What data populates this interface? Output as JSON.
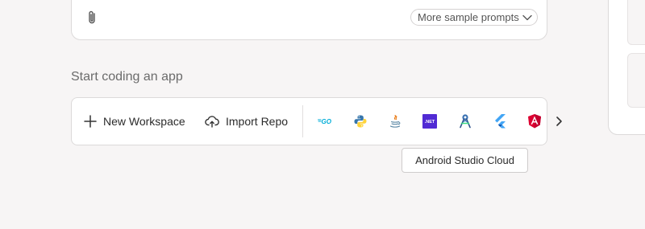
{
  "prompt_card": {
    "sample_prompts_label": "More sample prompts"
  },
  "start_section": {
    "heading": "Start coding an app",
    "new_workspace_label": "New Workspace",
    "import_repo_label": "Import Repo",
    "templates": [
      {
        "name": "go",
        "text": "GO"
      },
      {
        "name": "python",
        "text": ""
      },
      {
        "name": "java",
        "text": ""
      },
      {
        "name": "dotnet",
        "text": ".NET"
      },
      {
        "name": "android-studio",
        "text": ""
      },
      {
        "name": "flutter",
        "text": ""
      },
      {
        "name": "angular",
        "text": ""
      }
    ]
  },
  "tooltip": {
    "text": "Android Studio Cloud"
  },
  "colors": {
    "background": "#f7f5f5",
    "card": "#ffffff",
    "border": "#dcdada",
    "dotnet_purple": "#512bd4",
    "go_blue": "#00add8",
    "python_blue": "#3776ab",
    "python_yellow": "#ffd43b",
    "flutter_blue": "#42a5f5",
    "angular_red": "#dd0031"
  }
}
